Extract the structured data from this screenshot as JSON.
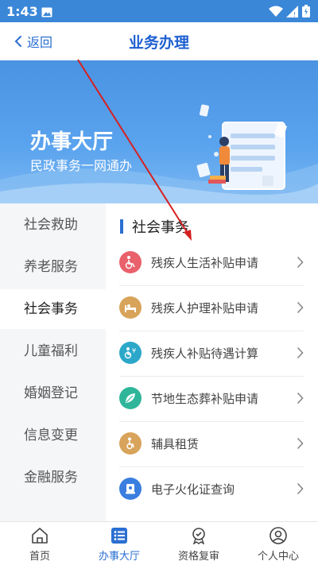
{
  "status": {
    "time": "1:43"
  },
  "header": {
    "back_label": "返回",
    "title": "业务办理"
  },
  "banner": {
    "title": "办事大厅",
    "subtitle": "民政事务一网通办"
  },
  "sidebar": {
    "items": [
      {
        "label": "社会救助"
      },
      {
        "label": "养老服务"
      },
      {
        "label": "社会事务"
      },
      {
        "label": "儿童福利"
      },
      {
        "label": "婚姻登记"
      },
      {
        "label": "信息变更"
      },
      {
        "label": "金融服务"
      }
    ],
    "active": "社会事务"
  },
  "section": {
    "title": "社会事务"
  },
  "services": [
    {
      "label": "残疾人生活补贴申请",
      "icon": "wheelchair-icon",
      "color": "#e9616b"
    },
    {
      "label": "残疾人护理补贴申请",
      "icon": "care-bed-icon",
      "color": "#d8a35a"
    },
    {
      "label": "残疾人补贴待遇计算",
      "icon": "calculator-icon",
      "color": "#2ba7c9"
    },
    {
      "label": "节地生态葬补贴申请",
      "icon": "leaf-icon",
      "color": "#2fb59a"
    },
    {
      "label": "辅具租赁",
      "icon": "assistive-device-icon",
      "color": "#d8a35a"
    },
    {
      "label": "电子火化证查询",
      "icon": "certificate-icon",
      "color": "#3a7ee0"
    }
  ],
  "bottom_nav": {
    "tabs": [
      {
        "label": "首页",
        "icon": "home-icon"
      },
      {
        "label": "办事大厅",
        "icon": "list-icon"
      },
      {
        "label": "资格复审",
        "icon": "badge-icon"
      },
      {
        "label": "个人中心",
        "icon": "user-icon"
      }
    ],
    "active": "办事大厅"
  },
  "colors": {
    "primary": "#2b6fd1",
    "statusbar": "#3a87d8",
    "banner": "#4a93e2",
    "annotation": "#d62020"
  }
}
